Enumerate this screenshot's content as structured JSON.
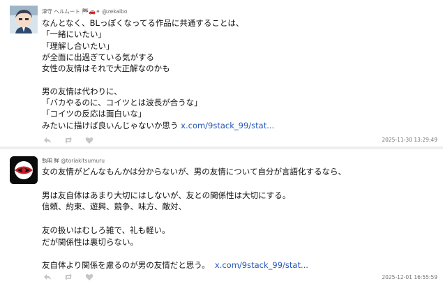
{
  "posts": [
    {
      "display_name": "津守 ヘルムート",
      "handle": "@zekaibo",
      "lines": [
        "なんとなく、BLっぽくなってる作品に共通することは、",
        "「一緒にいたい」",
        "「理解し合いたい」",
        "が全面に出過ぎている気がする",
        "女性の友情はそれで大正解なのかも",
        "",
        "男の友情は代わりに、",
        "「バカやるのに、コイツとは波長が合うな」",
        "「コイツの反応は面白いな」",
        "みたいに描けば良いんじゃないか思う"
      ],
      "link": "x.com/9stack_99/stat...",
      "timestamp": "2025-11-30 13:29:49"
    },
    {
      "display_name": "執明 眸",
      "handle": "@toriakitsumuru",
      "lines": [
        "女の友情がどんなもんかは分からないが、男の友情について自分が言語化するなら、",
        "",
        "男は友自体はあまり大切にはしないが、友との関係性は大切にする。",
        "信頼、約束、遊興、競争、味方、敵対、",
        "",
        "友の扱いはむしろ雑で、礼も軽い。",
        "だが関係性は裏切らない。",
        "",
        "友自体より関係を慮るのが男の友情だと思う。"
      ],
      "link": "x.com/9stack_99/stat...",
      "timestamp": "2025-12-01 16:55:59"
    }
  ],
  "icons": {
    "header_emojis": [
      "flag-icon",
      "car-icon",
      "star-icon"
    ],
    "actions": [
      "reply-icon",
      "retweet-icon",
      "like-icon"
    ]
  },
  "colors": {
    "link": "#2456b6",
    "meta": "#777777",
    "separator": "#eeeeee"
  }
}
